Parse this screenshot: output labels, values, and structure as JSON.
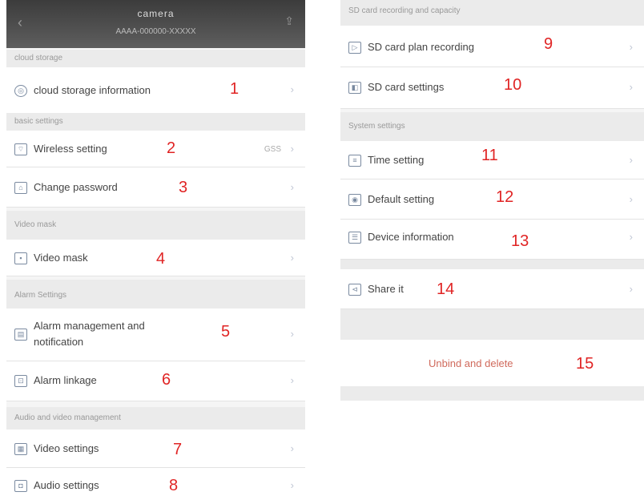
{
  "header": {
    "title": "camera",
    "subtitle": "AAAA-000000-XXXXX",
    "back_icon": "back-arrow-icon",
    "share_icon": "share-icon"
  },
  "left": {
    "sections": [
      "cloud storage",
      "basic settings",
      "Video mask",
      "Alarm Settings",
      "Audio and video management"
    ],
    "items": [
      {
        "label": "cloud storage information",
        "num": "1",
        "icon": "cloud-icon"
      },
      {
        "label": "Wireless setting",
        "num": "2",
        "icon": "wifi-icon",
        "value": "GSS"
      },
      {
        "label": "Change password",
        "num": "3",
        "icon": "lock-icon"
      },
      {
        "label": "Video mask",
        "num": "4",
        "icon": "mask-icon"
      },
      {
        "label": "Alarm management and",
        "label2": "notification",
        "num": "5",
        "icon": "alarm-icon"
      },
      {
        "label": "Alarm linkage",
        "num": "6",
        "icon": "link-icon"
      },
      {
        "label": "Video settings",
        "num": "7",
        "icon": "video-icon"
      },
      {
        "label": "Audio settings",
        "num": "8",
        "icon": "audio-icon"
      }
    ]
  },
  "right": {
    "sections": [
      "SD card recording and capacity",
      "System settings"
    ],
    "items": [
      {
        "label": "SD card plan recording",
        "num": "9",
        "icon": "record-icon"
      },
      {
        "label": "SD card settings",
        "num": "10",
        "icon": "sd-card-icon"
      },
      {
        "label": "Time setting",
        "num": "11",
        "icon": "clock-icon"
      },
      {
        "label": "Default setting",
        "num": "12",
        "icon": "reset-icon"
      },
      {
        "label": "Device information",
        "num": "13",
        "icon": "info-icon"
      },
      {
        "label": "Share it",
        "num": "14",
        "icon": "share-icon"
      }
    ],
    "danger": {
      "label": "Unbind and delete",
      "num": "15"
    }
  },
  "colors": {
    "annotation": "#e02424",
    "danger": "#d06a5c"
  }
}
